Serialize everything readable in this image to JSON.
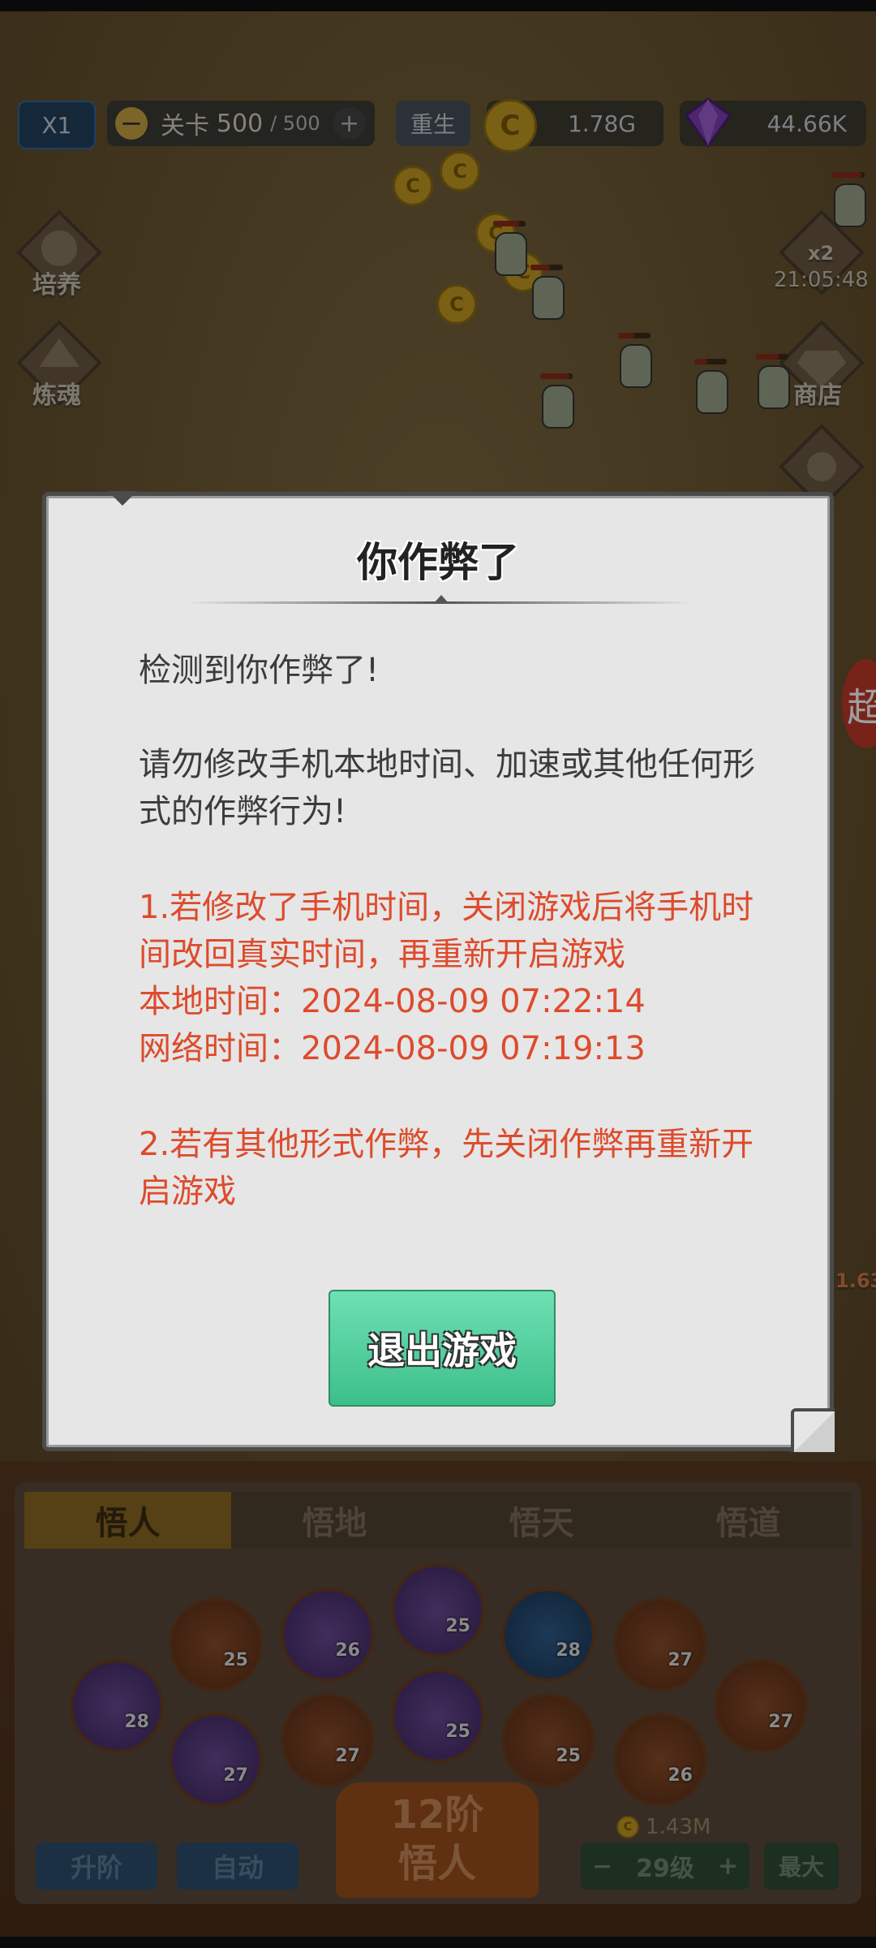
{
  "hud": {
    "speed": "X1",
    "stage_label": "关卡",
    "stage_current": "500",
    "stage_total": "/ 500",
    "minus": "−",
    "plus": "+",
    "rebirth": "重生",
    "gold": "1.78G",
    "gems": "44.66K"
  },
  "side": {
    "train": "培养",
    "refine": "炼魂",
    "boost_mult": "x2",
    "boost_timer": "21:05:48",
    "shop": "商店",
    "edge_badge": "超",
    "edge_number": "1.63"
  },
  "dialog": {
    "title": "你作弊了",
    "line1": "检测到你作弊了!",
    "line2": "请勿修改手机本地时间、加速或其他任何形式的作弊行为!",
    "step1": "1.若修改了手机时间，关闭游戏后将手机时间改回真实时间，再重新开启游戏",
    "local_time": "本地时间：2024-08-09 07:22:14",
    "network_time": "网络时间：2024-08-09 07:19:13",
    "step2": "2.若有其他形式作弊，先关闭作弊再重新开启游戏",
    "exit_button": "退出游戏"
  },
  "panel": {
    "tabs": [
      "悟人",
      "悟地",
      "悟天",
      "悟道"
    ],
    "zodiac_levels": {
      "rat": "28",
      "ox": "25",
      "tiger": "26",
      "rabbit": "25",
      "dragon": "28",
      "snake": "27",
      "horse": "27",
      "goat": "27",
      "monkey": "27",
      "rooster": "25",
      "dog": "25",
      "pig": "26"
    },
    "upgrade": "升阶",
    "auto": "自动",
    "rank_line1": "12阶",
    "rank_line2": "悟人",
    "cost": "1.43M",
    "level_minus": "−",
    "level": "29级",
    "level_plus": "+",
    "max": "最大"
  }
}
